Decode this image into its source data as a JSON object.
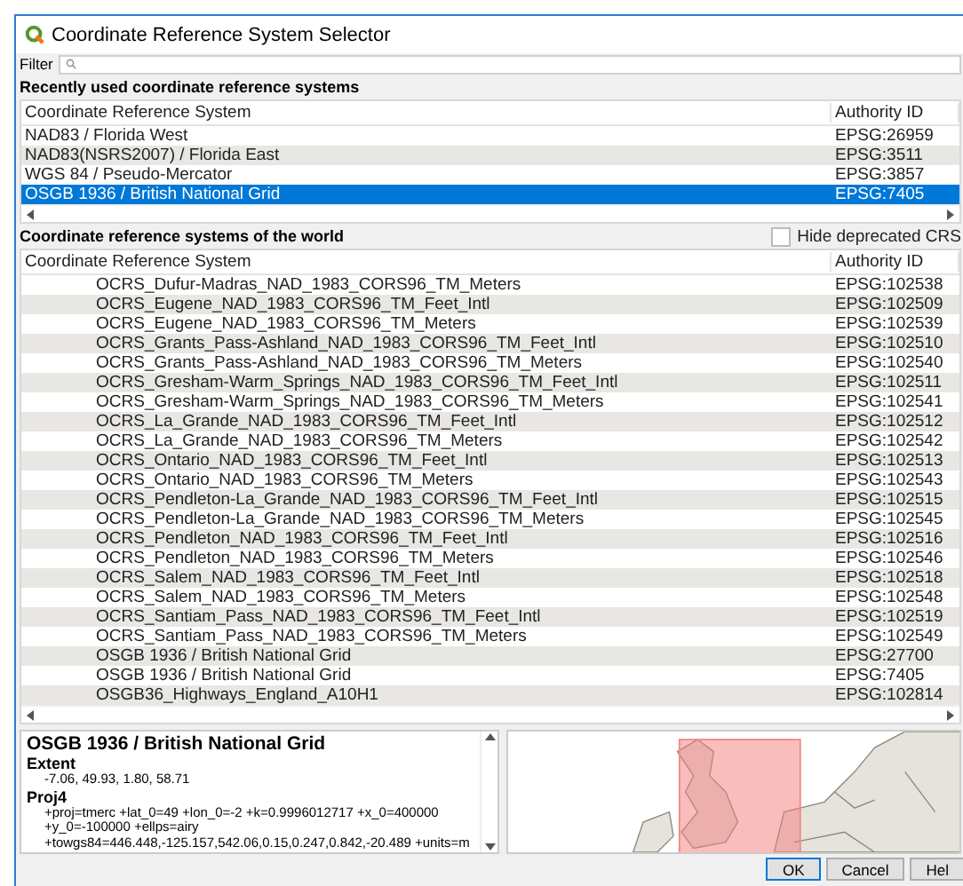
{
  "window": {
    "title": "Coordinate Reference System Selector"
  },
  "filter": {
    "label": "Filter"
  },
  "recent": {
    "heading": "Recently used coordinate reference systems",
    "columns": [
      "Coordinate Reference System",
      "Authority ID"
    ],
    "rows": [
      {
        "name": "NAD83 / Florida West",
        "authority": "EPSG:26959",
        "selected": false
      },
      {
        "name": "NAD83(NSRS2007) / Florida East",
        "authority": "EPSG:3511",
        "selected": false
      },
      {
        "name": "WGS 84 / Pseudo-Mercator",
        "authority": "EPSG:3857",
        "selected": false
      },
      {
        "name": "OSGB 1936 / British National Grid",
        "authority": "EPSG:7405",
        "selected": true
      }
    ]
  },
  "world": {
    "heading": "Coordinate reference systems of the world",
    "hide_deprecated": {
      "label": "Hide deprecated CRS",
      "checked": false
    },
    "columns": [
      "Coordinate Reference System",
      "Authority ID"
    ],
    "rows": [
      {
        "name": "OCRS_Dufur-Madras_NAD_1983_CORS96_TM_Meters",
        "authority": "EPSG:102538"
      },
      {
        "name": "OCRS_Eugene_NAD_1983_CORS96_TM_Feet_Intl",
        "authority": "EPSG:102509"
      },
      {
        "name": "OCRS_Eugene_NAD_1983_CORS96_TM_Meters",
        "authority": "EPSG:102539"
      },
      {
        "name": "OCRS_Grants_Pass-Ashland_NAD_1983_CORS96_TM_Feet_Intl",
        "authority": "EPSG:102510"
      },
      {
        "name": "OCRS_Grants_Pass-Ashland_NAD_1983_CORS96_TM_Meters",
        "authority": "EPSG:102540"
      },
      {
        "name": "OCRS_Gresham-Warm_Springs_NAD_1983_CORS96_TM_Feet_Intl",
        "authority": "EPSG:102511"
      },
      {
        "name": "OCRS_Gresham-Warm_Springs_NAD_1983_CORS96_TM_Meters",
        "authority": "EPSG:102541"
      },
      {
        "name": "OCRS_La_Grande_NAD_1983_CORS96_TM_Feet_Intl",
        "authority": "EPSG:102512"
      },
      {
        "name": "OCRS_La_Grande_NAD_1983_CORS96_TM_Meters",
        "authority": "EPSG:102542"
      },
      {
        "name": "OCRS_Ontario_NAD_1983_CORS96_TM_Feet_Intl",
        "authority": "EPSG:102513"
      },
      {
        "name": "OCRS_Ontario_NAD_1983_CORS96_TM_Meters",
        "authority": "EPSG:102543"
      },
      {
        "name": "OCRS_Pendleton-La_Grande_NAD_1983_CORS96_TM_Feet_Intl",
        "authority": "EPSG:102515"
      },
      {
        "name": "OCRS_Pendleton-La_Grande_NAD_1983_CORS96_TM_Meters",
        "authority": "EPSG:102545"
      },
      {
        "name": "OCRS_Pendleton_NAD_1983_CORS96_TM_Feet_Intl",
        "authority": "EPSG:102516"
      },
      {
        "name": "OCRS_Pendleton_NAD_1983_CORS96_TM_Meters",
        "authority": "EPSG:102546"
      },
      {
        "name": "OCRS_Salem_NAD_1983_CORS96_TM_Feet_Intl",
        "authority": "EPSG:102518"
      },
      {
        "name": "OCRS_Salem_NAD_1983_CORS96_TM_Meters",
        "authority": "EPSG:102548"
      },
      {
        "name": "OCRS_Santiam_Pass_NAD_1983_CORS96_TM_Feet_Intl",
        "authority": "EPSG:102519"
      },
      {
        "name": "OCRS_Santiam_Pass_NAD_1983_CORS96_TM_Meters",
        "authority": "EPSG:102549"
      },
      {
        "name": "OSGB 1936 / British National Grid",
        "authority": "EPSG:27700"
      },
      {
        "name": "OSGB 1936 / British National Grid",
        "authority": "EPSG:7405"
      },
      {
        "name": "OSGB36_Highways_England_A10H1",
        "authority": "EPSG:102814"
      }
    ]
  },
  "details": {
    "title": "OSGB 1936 / British National Grid",
    "sections": [
      {
        "heading": "Extent",
        "lines": [
          "-7.06, 49.93, 1.80, 58.71"
        ]
      },
      {
        "heading": "Proj4",
        "lines": [
          "+proj=tmerc +lat_0=49 +lon_0=-2 +k=0.9996012717 +x_0=400000",
          "+y_0=-100000 +ellps=airy",
          "+towgs84=446.448,-125.157,542.06,0.15,0.247,0.842,-20.489 +units=m"
        ]
      }
    ]
  },
  "buttons": [
    "OK",
    "Cancel",
    "Hel"
  ]
}
